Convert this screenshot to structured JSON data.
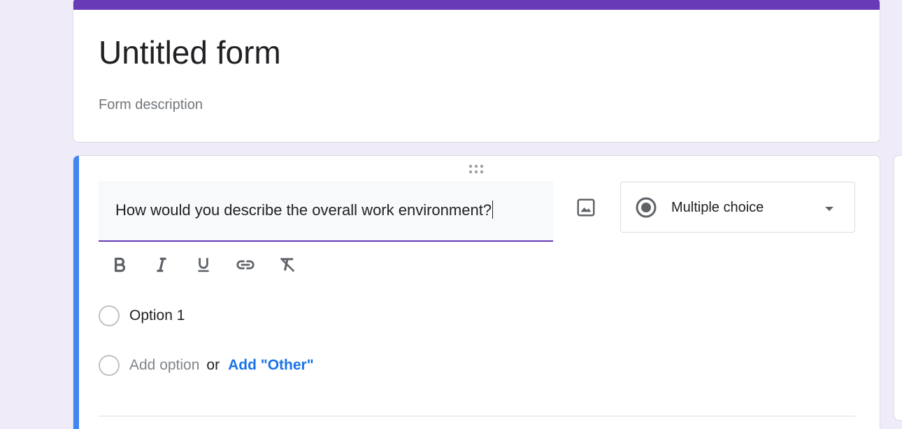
{
  "header": {
    "title": "Untitled form",
    "description_placeholder": "Form description",
    "accent_color": "#673ab7"
  },
  "question": {
    "text": "How would you describe the overall work environment?",
    "accent_color": "#4285f4",
    "type_label": "Multiple choice",
    "image_icon": "image-icon",
    "formatting": [
      {
        "name": "bold-icon",
        "glyph": "B"
      },
      {
        "name": "italic-icon",
        "glyph": "I"
      },
      {
        "name": "underline-icon",
        "glyph": "U"
      },
      {
        "name": "link-icon",
        "glyph": "link"
      },
      {
        "name": "clear-formatting-icon",
        "glyph": "Tx"
      }
    ],
    "options": [
      {
        "label": "Option 1"
      }
    ],
    "add_option_label": "Add option",
    "or_label": "or",
    "add_other_label": "Add \"Other\""
  }
}
